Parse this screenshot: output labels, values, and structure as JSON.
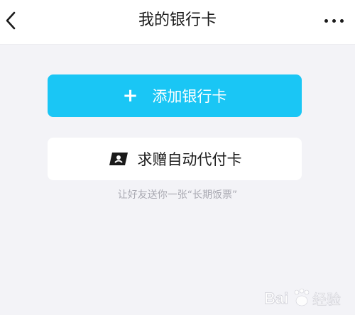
{
  "header": {
    "title": "我的银行卡",
    "back_icon": "chevron-left-icon",
    "more_icon": "more-horizontal-icon"
  },
  "actions": {
    "add_card_icon": "plus-icon",
    "add_card_label": "添加银行卡",
    "gift_card_icon": "gift-card-icon",
    "gift_card_label": "求赠自动代付卡"
  },
  "hint": "让好友送你一张“长期饭票”",
  "watermark": {
    "text": "Baidu 经验"
  },
  "colors": {
    "accent": "#1ac6f5",
    "background": "#f3f3f7",
    "hint": "#a9a9b2"
  }
}
